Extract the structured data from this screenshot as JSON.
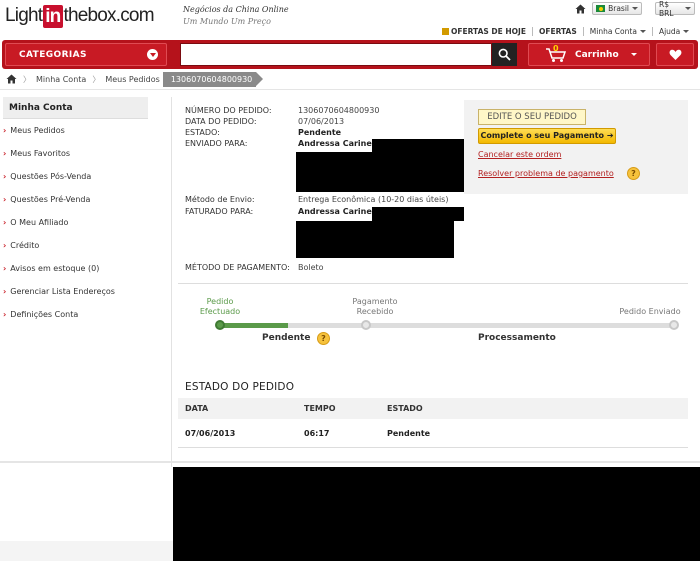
{
  "header": {
    "logo_pre": "Light",
    "logo_in": "in",
    "logo_post": "thebox.com",
    "tagline1": "Negócios da China Online",
    "tagline2": "Um Mundo Um Preço",
    "language": "Brasil",
    "currency": "R$ BRL",
    "links": {
      "deals": "OFERTAS DE HOJE",
      "offers": "OFERTAS",
      "account": "Minha Conta",
      "help": "Ajuda"
    }
  },
  "navbar": {
    "categories": "CATEGORIAS",
    "search_placeholder": "",
    "cart_label": "Carrinho",
    "cart_count": "0"
  },
  "breadcrumb": {
    "items": [
      "Minha Conta",
      "Meus Pedidos"
    ],
    "current": "1306070604800930"
  },
  "sidebar": {
    "title": "Minha Conta",
    "items": [
      "Meus Pedidos",
      "Meus Favoritos",
      "Questões Pós-Venda",
      "Questões Pré-Venda",
      "O Meu Afiliado",
      "Crédito",
      "Avisos em estoque (0)",
      "Gerenciar Lista Endereços",
      "Definições Conta"
    ]
  },
  "order": {
    "number_label": "NÚMERO DO PEDIDO:",
    "number": "1306070604800930",
    "date_label": "DATA DO PEDIDO:",
    "date": "07/06/2013",
    "status_label": "ESTADO:",
    "status": "Pendente",
    "ship_to_label": "ENVIADO PARA:",
    "ship_to_name": "Andressa Carine",
    "shipping_method_label": "Método de Envio:",
    "shipping_method": "Entrega Econômica (10-20 dias úteis)",
    "bill_to_label": "FATURADO PARA:",
    "bill_to_name": "Andressa Carine",
    "payment_method_label": "MÉTODO DE PAGAMENTO:",
    "payment_method": "Boleto"
  },
  "actions": {
    "edit": "EDITE O SEU PEDIDO",
    "complete_payment": "Complete o seu Pagamento",
    "cancel": "Cancelar este ordem",
    "resolve": "Resolver problema de pagamento"
  },
  "progress": {
    "steps": [
      {
        "line1": "Pedido",
        "line2": "Efectuado",
        "color": "#5a9a49"
      },
      {
        "line1": "Pagamento",
        "line2": "Recebido",
        "color": "#777777"
      },
      {
        "line1": "Pedido Enviado",
        "line2": "",
        "color": "#777777"
      }
    ],
    "phase1": "Pendente",
    "phase2": "Processamento",
    "completed_fraction": 0.15
  },
  "status_table": {
    "title": "ESTADO DO PEDIDO",
    "headers": [
      "DATA",
      "TEMPO",
      "ESTADO"
    ],
    "rows": [
      [
        "07/06/2013",
        "06:17",
        "Pendente"
      ]
    ]
  },
  "colors": {
    "brand_red": "#b5121b",
    "complete_green": "#5a9a49",
    "link_red": "#b32020"
  }
}
